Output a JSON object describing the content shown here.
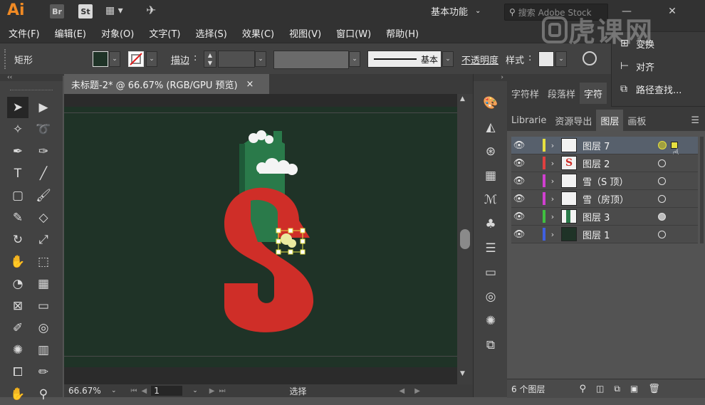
{
  "app": {
    "logo": "Ai",
    "bridge": "Br",
    "stock": "St",
    "workspace": "基本功能",
    "search_placeholder": "搜索 Adobe Stock",
    "watermark": "虎课网"
  },
  "menu": [
    "文件(F)",
    "编辑(E)",
    "对象(O)",
    "文字(T)",
    "选择(S)",
    "效果(C)",
    "视图(V)",
    "窗口(W)",
    "帮助(H)"
  ],
  "control": {
    "selection_type": "矩形",
    "stroke_label": "描边",
    "stroke_style": "基本",
    "opacity_label": "不透明度",
    "style_label": "样式"
  },
  "flyout": {
    "items": [
      "变换",
      "对齐",
      "路径查找..."
    ]
  },
  "document": {
    "tab_title": "未标题-2* @ 66.67% (RGB/GPU 预览)",
    "close": "×",
    "zoom": "66.67%",
    "page": "1",
    "status_tool": "选择"
  },
  "char_panel": {
    "tabs": [
      "字符样",
      "段落样",
      "字符"
    ]
  },
  "layers_panel": {
    "tabs": [
      "Librarie",
      "资源导出",
      "图层",
      "画板"
    ],
    "layers": [
      {
        "name": "图层 7",
        "color": "#e6e040",
        "selected": true
      },
      {
        "name": "图层 2",
        "color": "#e04040",
        "selected": false
      },
      {
        "name": "雪（S 顶）",
        "color": "#d040d0",
        "selected": false
      },
      {
        "name": "雪（房顶）",
        "color": "#d040d0",
        "selected": false
      },
      {
        "name": "图层 3",
        "color": "#40c040",
        "selected": false
      },
      {
        "name": "图层 1",
        "color": "#4060e0",
        "selected": false
      }
    ],
    "footer": "6 个图层"
  },
  "colors": {
    "artboard_bg": "#1f3327",
    "s_red": "#cf2e28",
    "house_green": "#2a7a4a",
    "accent_orange": "#f08a24"
  }
}
